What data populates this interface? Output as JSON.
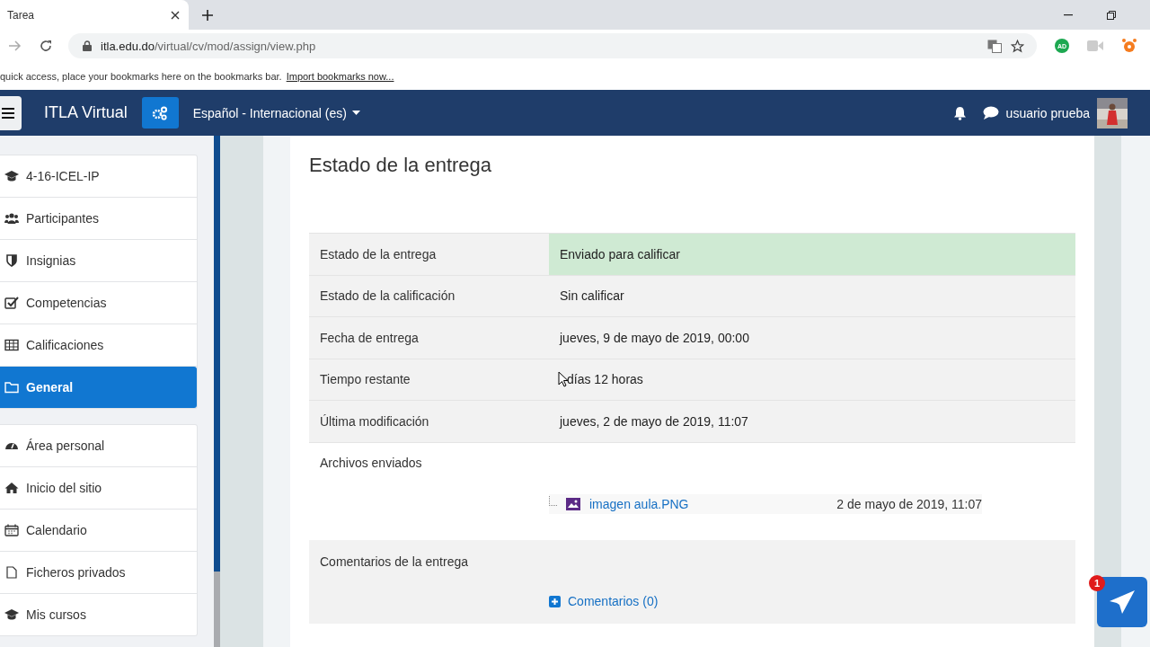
{
  "browser": {
    "tab_title": "Tarea",
    "url_host": "itla.edu.do",
    "url_path": "/virtual/cv/mod/assign/view.php",
    "bookmarks_hint": "quick access, place your bookmarks here on the bookmarks bar.",
    "bookmarks_link": "Import bookmarks now...",
    "extension_badge": "AD"
  },
  "navbar": {
    "site_name": "ITLA Virtual",
    "language": "Español - Internacional (es)",
    "user_name": "usuario prueba"
  },
  "sidebar": {
    "groups": [
      {
        "items": [
          {
            "label": "4-16-ICEL-IP",
            "selected": false
          },
          {
            "label": "Participantes",
            "selected": false
          },
          {
            "label": "Insignias",
            "selected": false
          },
          {
            "label": "Competencias",
            "selected": false
          },
          {
            "label": "Calificaciones",
            "selected": false
          },
          {
            "label": "General",
            "selected": true
          }
        ]
      },
      {
        "items": [
          {
            "label": "Área personal",
            "selected": false
          },
          {
            "label": "Inicio del sitio",
            "selected": false
          },
          {
            "label": "Calendario",
            "selected": false
          },
          {
            "label": "Ficheros privados",
            "selected": false
          },
          {
            "label": "Mis cursos",
            "selected": false
          }
        ]
      }
    ]
  },
  "main": {
    "heading": "Estado de la entrega",
    "rows": [
      {
        "label": "Estado de la entrega",
        "value": "Enviado para calificar",
        "highlight": true
      },
      {
        "label": "Estado de la calificación",
        "value": "Sin calificar",
        "highlight": false
      },
      {
        "label": "Fecha de entrega",
        "value": "jueves, 9 de mayo de 2019, 00:00",
        "highlight": false
      },
      {
        "label": "Tiempo restante",
        "value": "días 12 horas",
        "highlight": false,
        "pointer": true
      },
      {
        "label": "Última modificación",
        "value": "jueves, 2 de mayo de 2019, 11:07",
        "highlight": false
      }
    ],
    "files": {
      "label": "Archivos enviados",
      "items": [
        {
          "name": "imagen aula.PNG",
          "date": "2 de mayo de 2019, 11:07"
        }
      ]
    },
    "comments": {
      "label": "Comentarios de la entrega",
      "link": "Comentarios (0)"
    }
  },
  "chat_button": {
    "badge": "1"
  }
}
